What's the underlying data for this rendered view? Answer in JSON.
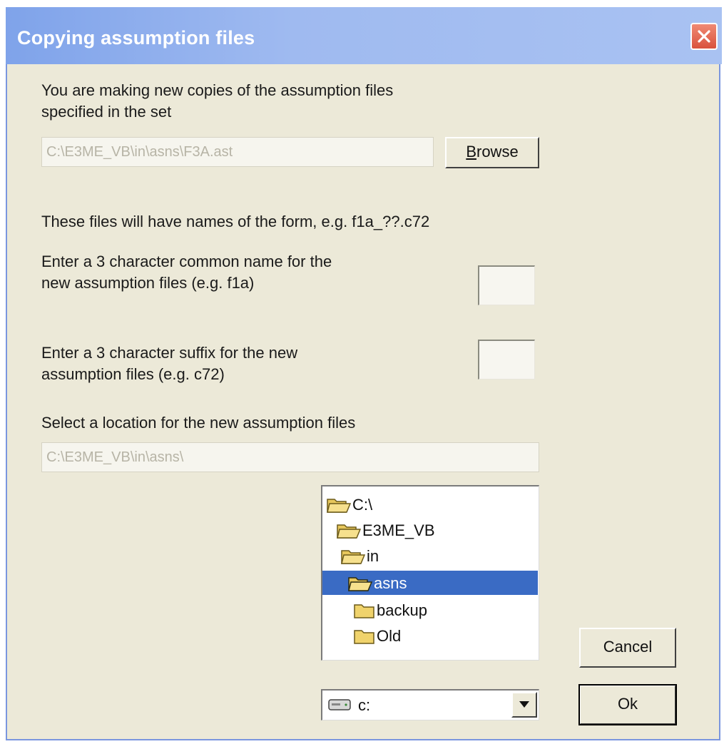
{
  "window": {
    "title": "Copying assumption files",
    "close_icon": "close-icon"
  },
  "intro": {
    "line1": "You are making new copies of the assumption files",
    "line2": "specified in the set"
  },
  "set_file": {
    "value": "C:\\E3ME_VB\\in\\asns\\F3A.ast"
  },
  "browse_button": {
    "label_prefix": "",
    "label_mnemonic": "B",
    "label_rest": "rowse"
  },
  "form_hint": "These files will have names of the form, e.g. f1a_??.c72",
  "common_name": {
    "line1": "Enter a 3 character common name for the",
    "line2": "new assumption files (e.g. f1a)",
    "value": ""
  },
  "suffix": {
    "line1": "Enter a 3 character suffix for the new",
    "line2": "assumption files (e.g. c72)",
    "value": ""
  },
  "location": {
    "label": "Select a location for the new assumption files",
    "value": "C:\\E3ME_VB\\in\\asns\\"
  },
  "directory_list": {
    "items": [
      {
        "label": "C:\\",
        "icon": "open-folder-icon",
        "selected": false
      },
      {
        "label": "E3ME_VB",
        "icon": "open-folder-icon",
        "selected": false
      },
      {
        "label": "in",
        "icon": "open-folder-icon",
        "selected": false
      },
      {
        "label": "asns",
        "icon": "open-folder-icon",
        "selected": true
      },
      {
        "label": "backup",
        "icon": "folder-icon",
        "selected": false
      },
      {
        "label": "Old",
        "icon": "folder-icon",
        "selected": false
      }
    ]
  },
  "drive_select": {
    "value": "c:",
    "icon": "drive-icon"
  },
  "buttons": {
    "cancel": "Cancel",
    "ok": "Ok"
  },
  "colors": {
    "title_bar": "#9fbaf0",
    "dialog_bg": "#ece9d8",
    "selection": "#3a6bc4",
    "close_button": "#d9523d"
  }
}
